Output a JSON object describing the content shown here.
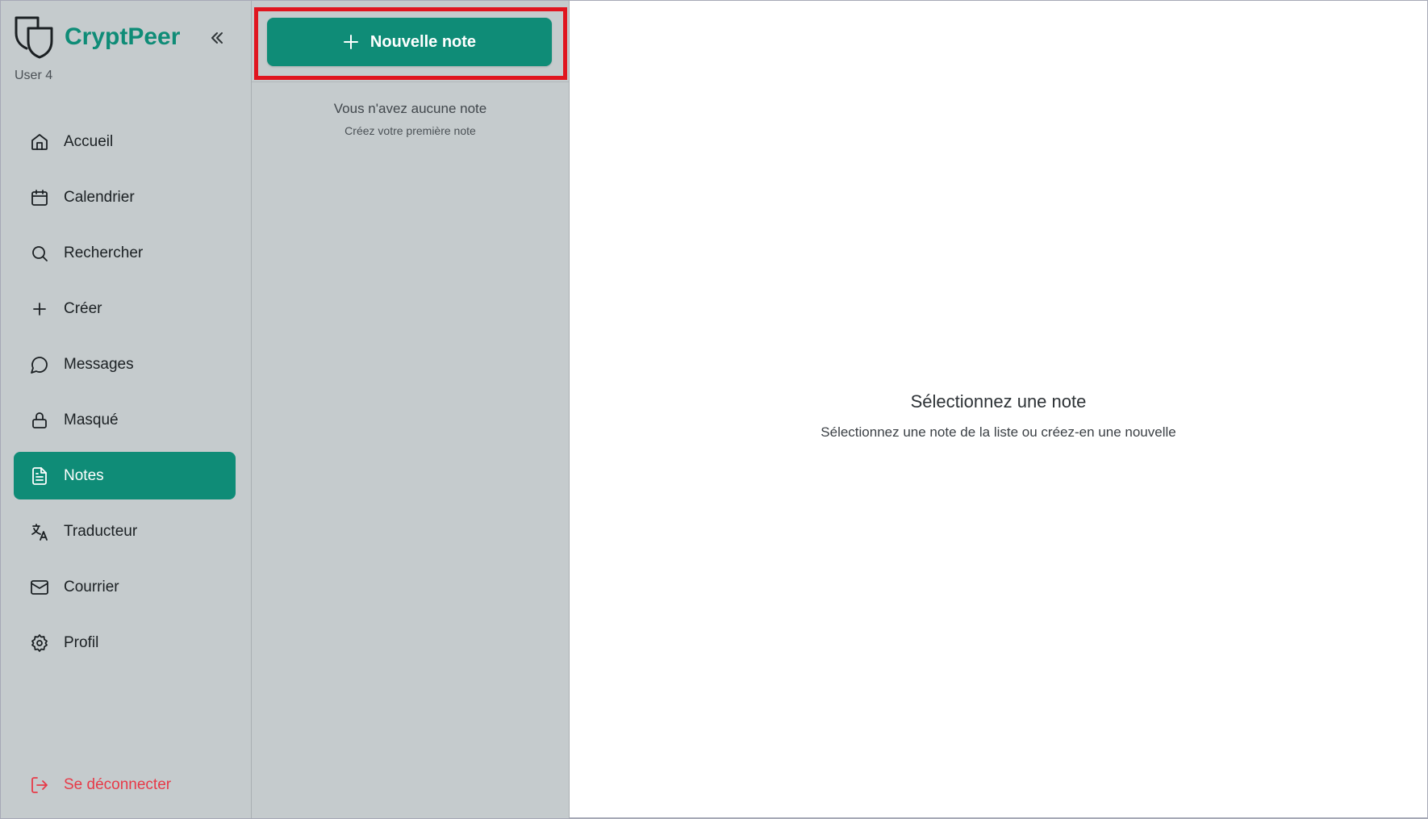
{
  "app": {
    "name": "CryptPeer",
    "user": "User 4"
  },
  "sidebar": {
    "items": [
      {
        "label": "Accueil",
        "icon": "home-icon"
      },
      {
        "label": "Calendrier",
        "icon": "calendar-icon"
      },
      {
        "label": "Rechercher",
        "icon": "search-icon"
      },
      {
        "label": "Créer",
        "icon": "plus-icon"
      },
      {
        "label": "Messages",
        "icon": "message-icon"
      },
      {
        "label": "Masqué",
        "icon": "lock-icon"
      },
      {
        "label": "Notes",
        "icon": "file-text-icon",
        "active": true
      },
      {
        "label": "Traducteur",
        "icon": "translate-icon"
      },
      {
        "label": "Courrier",
        "icon": "mail-icon"
      },
      {
        "label": "Profil",
        "icon": "gear-icon"
      }
    ],
    "logout": "Se déconnecter"
  },
  "notes": {
    "new_button": "Nouvelle note",
    "empty_title": "Vous n'avez aucune note",
    "empty_subtitle": "Créez votre première note"
  },
  "main": {
    "title": "Sélectionnez une note",
    "subtitle": "Sélectionnez une note de la liste ou créez-en une nouvelle"
  },
  "colors": {
    "accent": "#0f8c77",
    "sidebar_bg": "#c5cbcd",
    "logout": "#e73a48",
    "highlight": "#e0151f"
  }
}
